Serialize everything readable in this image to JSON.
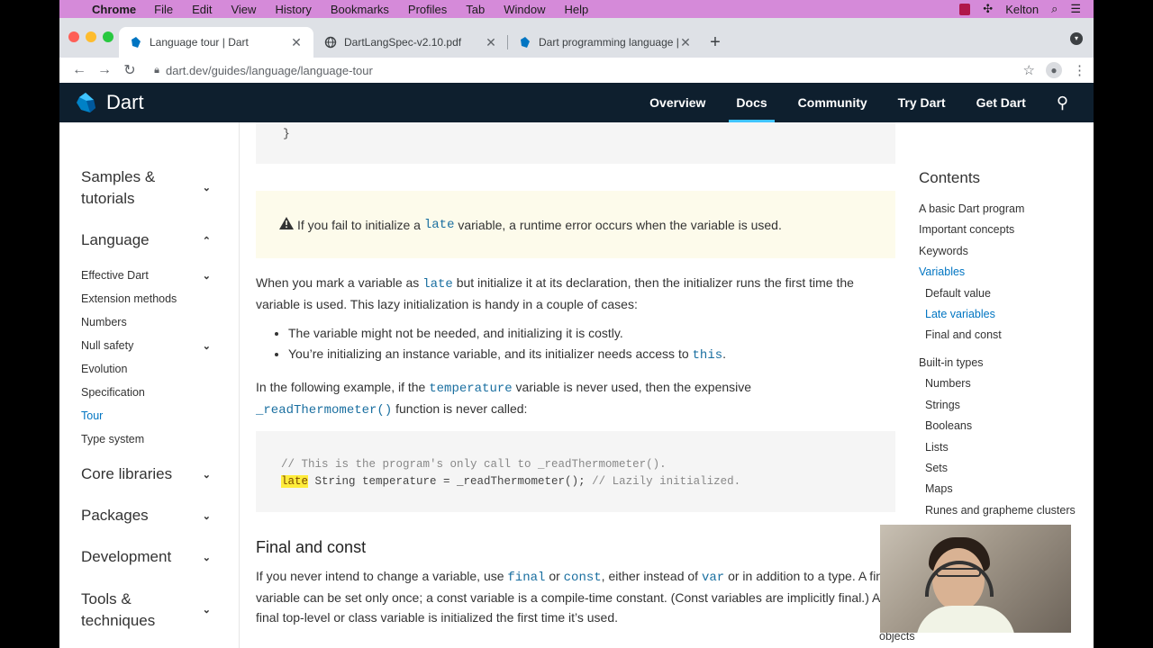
{
  "menubar": {
    "app": "Chrome",
    "items": [
      "File",
      "Edit",
      "View",
      "History",
      "Bookmarks",
      "Profiles",
      "Tab",
      "Window",
      "Help"
    ],
    "user": "Kelton"
  },
  "tabs": [
    {
      "title": "Language tour | Dart",
      "active": true
    },
    {
      "title": "DartLangSpec-v2.10.pdf",
      "active": false
    },
    {
      "title": "Dart programming language | D",
      "active": false
    }
  ],
  "address": "dart.dev/guides/language/language-tour",
  "site": {
    "logo_text": "Dart",
    "nav": [
      "Overview",
      "Docs",
      "Community",
      "Try Dart",
      "Get Dart"
    ],
    "active_nav": "Docs"
  },
  "sidebar": {
    "samples": "Samples & tutorials",
    "language": "Language",
    "items": [
      "Effective Dart",
      "Extension methods",
      "Numbers",
      "Null safety",
      "Evolution",
      "Specification",
      "Tour",
      "Type system"
    ],
    "core": "Core libraries",
    "packages": "Packages",
    "development": "Development",
    "tools": "Tools & techniques"
  },
  "content": {
    "code_top": "}",
    "alert_pre": "If you fail to initialize a",
    "alert_code": "late",
    "alert_post": "variable, a runtime error occurs when the variable is used.",
    "p1_a": "When you mark a variable as",
    "p1_code": "late",
    "p1_b": "but initialize it at its declaration, then the initializer runs the first time the variable is used. This lazy initialization is handy in a couple of cases:",
    "bullet1": "The variable might not be needed, and initializing it is costly.",
    "bullet2_a": "You’re initializing an instance variable, and its initializer needs access to",
    "bullet2_code": "this",
    "bullet2_b": ".",
    "p2_a": "In the following example, if the",
    "p2_code1": "temperature",
    "p2_b": "variable is never used, then the expensive",
    "p2_code2": "_readThermometer()",
    "p2_c": "function is never called:",
    "code_comment": "// This is the program's only call to _readThermometer().",
    "code_late": "late",
    "code_rest": " String temperature = _readThermometer();",
    "code_comment2": " // Lazily initialized.",
    "h2": "Final and const",
    "p3_a": "If you never intend to change a variable, use",
    "p3_c1": "final",
    "p3_b": "or",
    "p3_c2": "const",
    "p3_c": ", either instead of",
    "p3_c3": "var",
    "p3_d": "or in addition to a type. A final variable can be set only once; a const variable is a compile-time constant. (Const variables are implicitly final.) A final top-level or class variable is initialized the first time it’s used."
  },
  "toc": {
    "head": "Contents",
    "items": [
      {
        "label": "A basic Dart program",
        "sub": false
      },
      {
        "label": "Important concepts",
        "sub": false
      },
      {
        "label": "Keywords",
        "sub": false
      },
      {
        "label": "Variables",
        "sub": false,
        "active": true
      },
      {
        "label": "Default value",
        "sub": true
      },
      {
        "label": "Late variables",
        "sub": true,
        "active": true
      },
      {
        "label": "Final and const",
        "sub": true
      },
      {
        "label": "Built-in types",
        "sub": false
      },
      {
        "label": "Numbers",
        "sub": true
      },
      {
        "label": "Strings",
        "sub": true
      },
      {
        "label": "Booleans",
        "sub": true
      },
      {
        "label": "Lists",
        "sub": true
      },
      {
        "label": "Sets",
        "sub": true
      },
      {
        "label": "Maps",
        "sub": true
      },
      {
        "label": "Runes and grapheme clusters",
        "sub": true
      }
    ],
    "tail": "objects"
  }
}
